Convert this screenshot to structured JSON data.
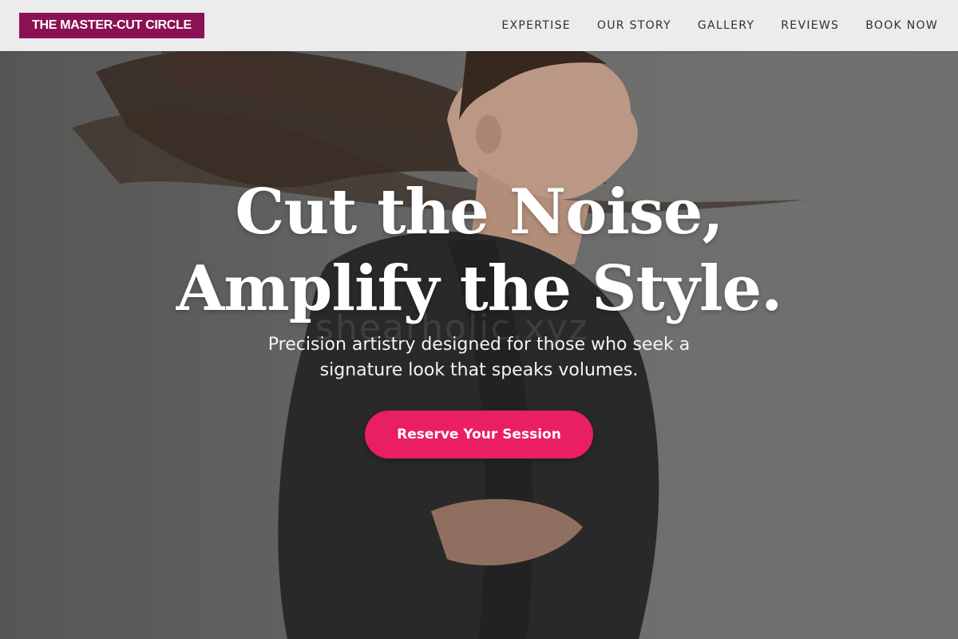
{
  "header": {
    "logo_text": "THE MASTER-CUT CIRCLE",
    "nav": [
      {
        "label": "EXPERTISE"
      },
      {
        "label": "OUR STORY"
      },
      {
        "label": "GALLERY"
      },
      {
        "label": "REVIEWS"
      },
      {
        "label": "BOOK NOW"
      }
    ]
  },
  "hero": {
    "headline_line1": "Cut the Noise,",
    "headline_line2": "Amplify the Style.",
    "subheadline": "Precision artistry designed for those who seek a signature look that speaks volumes.",
    "cta_label": "Reserve Your Session",
    "watermark": "shearholic.xyz"
  },
  "colors": {
    "brand": "#8b1155",
    "accent": "#e91e63",
    "header_bg": "#ececec",
    "nav_text": "#2f2f38"
  }
}
